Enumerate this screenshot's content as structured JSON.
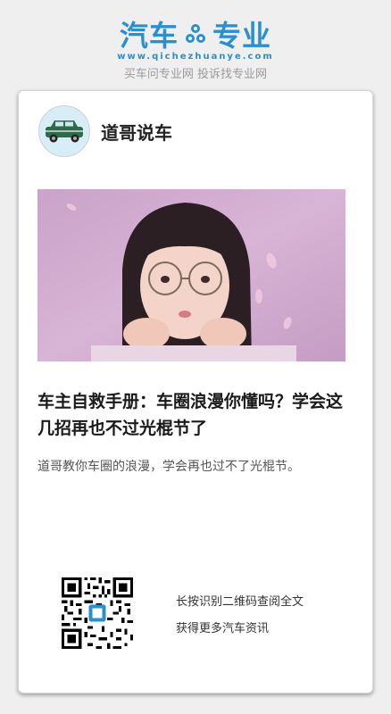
{
  "logo": {
    "left_text": "汽车",
    "right_text": "专业",
    "url": "www.qichezhuanye.com",
    "slogan": "买车问专业网 投诉找专业网",
    "brand_color": "#2a8fcf"
  },
  "author": {
    "name": "道哥说车",
    "avatar_icon": "car-icon"
  },
  "article": {
    "title": "车主自救手册：车圈浪漫你懂吗？学会这几招再也不过光棍节了",
    "summary": "道哥教你车圈的浪漫，学会再也过不了光棍节。"
  },
  "qr": {
    "line1": "长按识别二维码查阅全文",
    "line2": "获得更多汽车资讯"
  }
}
